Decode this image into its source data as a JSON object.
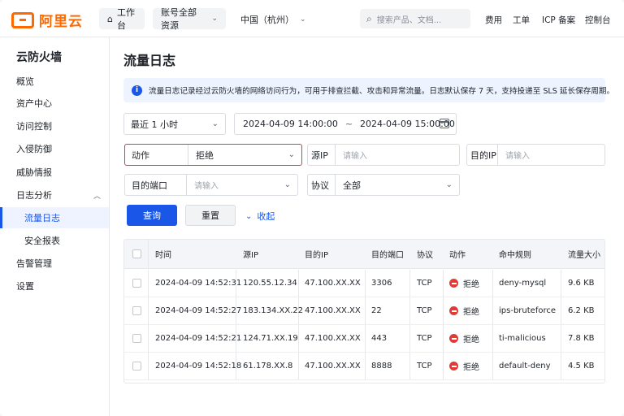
{
  "brand": {
    "name": "阿里云",
    "color": "#ff6a00"
  },
  "topbar": {
    "workbench": "工作台",
    "resources": "账号全部资源",
    "region": "中国（杭州）",
    "search_placeholder": "搜索产品、文档...",
    "links": [
      "费用",
      "工单",
      "ICP 备案",
      "控制台"
    ]
  },
  "sidebar": {
    "title": "云防火墙",
    "items": [
      {
        "label": "概览"
      },
      {
        "label": "资产中心"
      },
      {
        "label": "访问控制"
      },
      {
        "label": "入侵防御"
      },
      {
        "label": "威胁情报"
      },
      {
        "label": "日志分析",
        "expanded": true
      },
      {
        "label": "流量日志",
        "active": true
      },
      {
        "label": "安全报表"
      },
      {
        "label": "告警管理"
      },
      {
        "label": "设置"
      }
    ]
  },
  "main": {
    "title": "流量日志",
    "notice": "流量日志记录经过云防火墙的网络访问行为，可用于排查拦截、攻击和异常流量。日志默认保存 7 天，支持投递至 SLS 延长保存周期。",
    "filters": {
      "time_range": "最近 1 小时",
      "start": "2024-04-09 14:00:00",
      "range_sep": "~",
      "end": "2024-04-09 15:00:00",
      "action_label": "动作",
      "action_value": "拒绝",
      "src_ip_label": "源IP",
      "src_ip_placeholder": "请输入",
      "dst_ip_label": "目的IP",
      "dst_ip_placeholder": "请输入",
      "dst_port_label": "目的端口",
      "dst_port_placeholder": "请输入",
      "protocol_label": "协议",
      "protocol_value": "全部"
    },
    "buttons": {
      "query": "查询",
      "reset": "重置",
      "collapse": "收起"
    },
    "table": {
      "columns": [
        "时间",
        "源IP",
        "目的IP",
        "目的端口",
        "协议",
        "动作",
        "命中规则",
        "流量大小"
      ],
      "rows": [
        {
          "time": "2024-04-09 14:52:31",
          "src": "120.55.12.34",
          "dst": "47.100.XX.XX",
          "port": "3306",
          "proto": "TCP",
          "action": "拒绝",
          "rule": "deny-mysql",
          "size": "9.6 KB"
        },
        {
          "time": "2024-04-09 14:52:27",
          "src": "183.134.XX.22",
          "dst": "47.100.XX.XX",
          "port": "22",
          "proto": "TCP",
          "action": "拒绝",
          "rule": "ips-bruteforce",
          "size": "6.2 KB"
        },
        {
          "time": "2024-04-09 14:52:21",
          "src": "124.71.XX.19",
          "dst": "47.100.XX.XX",
          "port": "443",
          "proto": "TCP",
          "action": "拒绝",
          "rule": "ti-malicious",
          "size": "7.8 KB"
        },
        {
          "time": "2024-04-09 14:52:18",
          "src": "61.178.XX.8",
          "dst": "47.100.XX.XX",
          "port": "8888",
          "proto": "TCP",
          "action": "拒绝",
          "rule": "default-deny",
          "size": "4.5 KB"
        }
      ]
    }
  },
  "colors": {
    "primary": "#1a56e8",
    "deny": "#e53935",
    "highlight": "#e53935"
  }
}
